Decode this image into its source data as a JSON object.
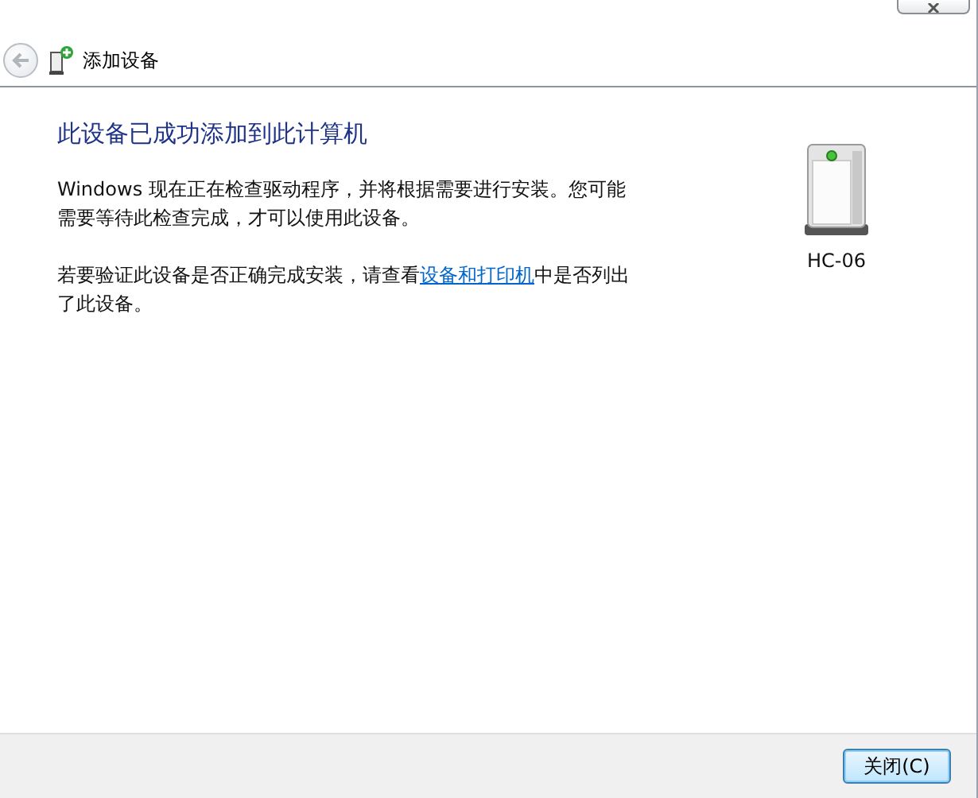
{
  "nav": {
    "title": "添加设备"
  },
  "content": {
    "heading": "此设备已成功添加到此计算机",
    "paragraph": "Windows 现在正在检查驱动程序，并将根据需要进行安装。您可能需要等待此检查完成，才可以使用此设备。",
    "verify": {
      "before": "若要验证此设备是否正确完成安装，请查看",
      "link": "设备和打印机",
      "after": "中是否列出了此设备。"
    }
  },
  "device": {
    "name": "HC-06"
  },
  "buttons": [
    {
      "label": "关闭(C)",
      "kind": "default"
    }
  ]
}
